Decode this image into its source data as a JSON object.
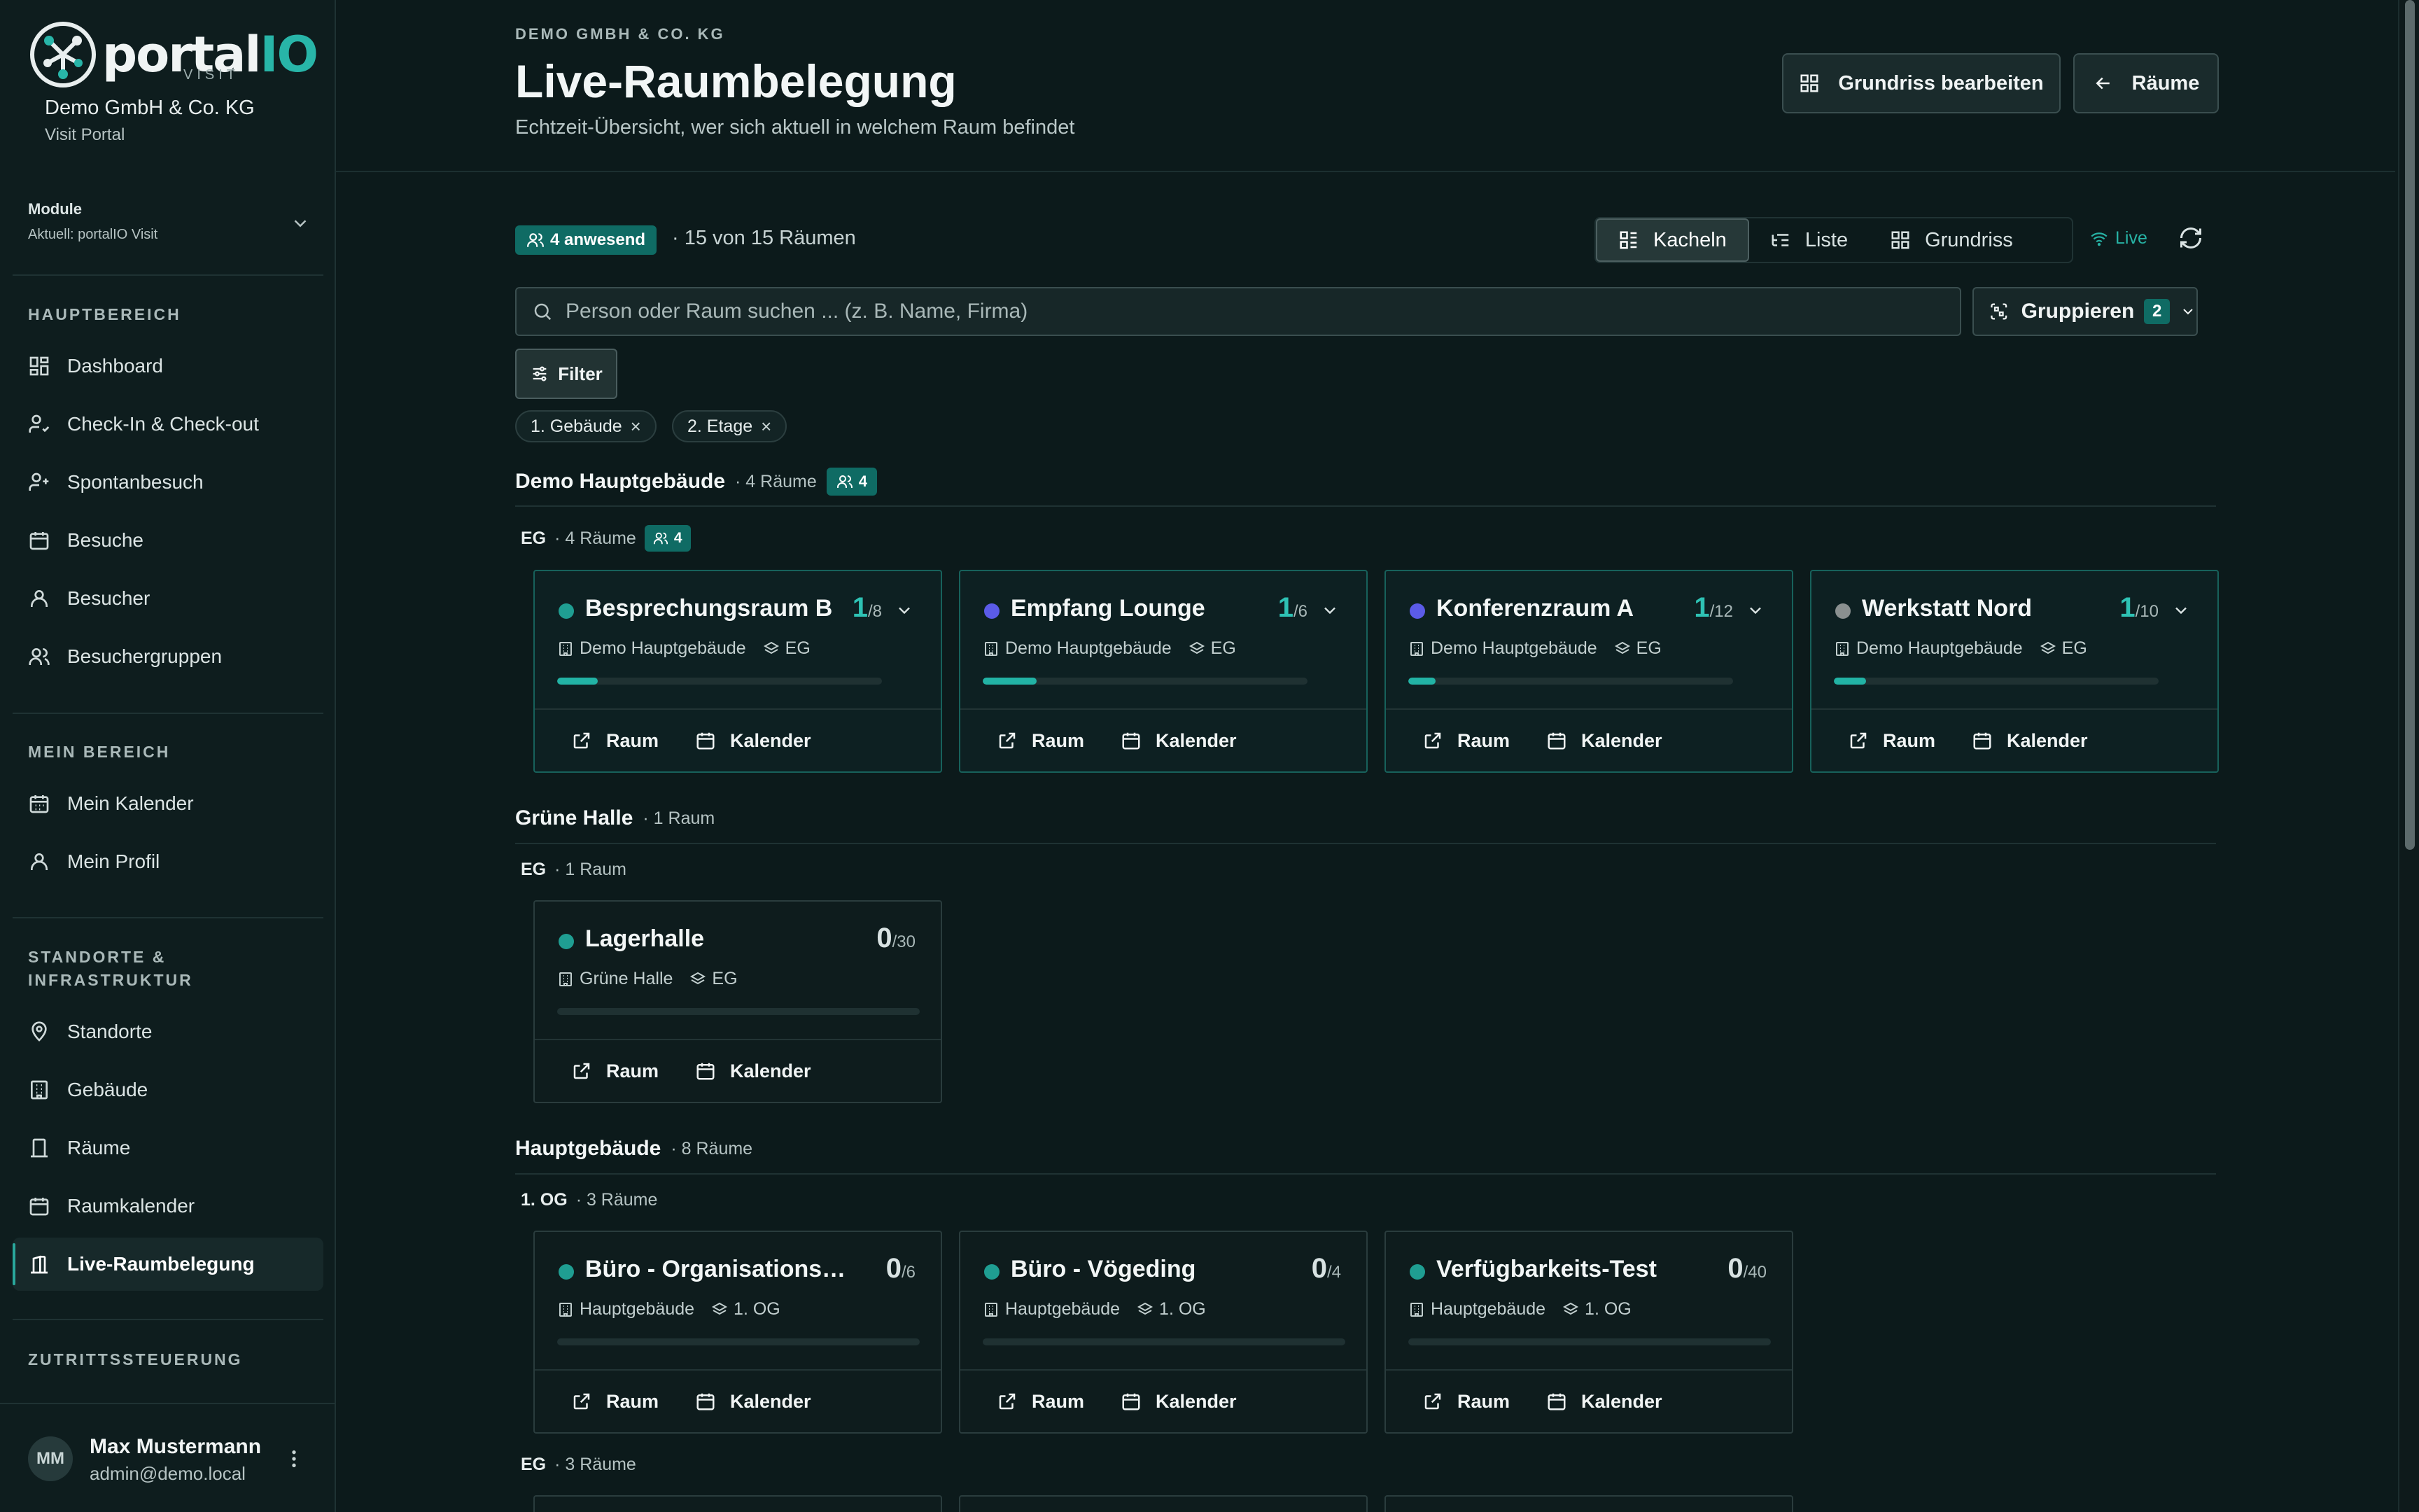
{
  "brand": {
    "name_part1": "portal",
    "name_part2": "IO",
    "sub": "VISIT",
    "company": "Demo GmbH & Co. KG",
    "portal": "Visit Portal"
  },
  "module": {
    "label": "Module",
    "current": "Aktuell: portalIO Visit"
  },
  "sections": {
    "main": "HAUPTBEREICH",
    "mine": "MEIN BEREICH",
    "infra": "STANDORTE & INFRASTRUKTUR",
    "access": "ZUTRITTSSTEUERUNG"
  },
  "nav": {
    "dashboard": "Dashboard",
    "checkin": "Check-In & Check-out",
    "spontan": "Spontanbesuch",
    "besuche": "Besuche",
    "besucher": "Besucher",
    "gruppen": "Besuchergruppen",
    "kalender": "Mein Kalender",
    "profil": "Mein Profil",
    "standorte": "Standorte",
    "gebaeude": "Gebäude",
    "raeume": "Räume",
    "raumkalender": "Raumkalender",
    "live": "Live-Raumbelegung"
  },
  "user": {
    "initials": "MM",
    "name": "Max Mustermann",
    "email": "admin@demo.local"
  },
  "header": {
    "org": "DEMO GMBH & CO. KG",
    "title": "Live-Raumbelegung",
    "subtitle": "Echtzeit-Übersicht, wer sich aktuell in welchem Raum befindet",
    "edit_button": "Grundriss bearbeiten",
    "rooms_button": "Räume"
  },
  "toolbar": {
    "present": "4 anwesend",
    "count": "· 15 von 15 Räumen",
    "views": {
      "tiles": "Kacheln",
      "list": "Liste",
      "floorplan": "Grundriss"
    },
    "live": "Live",
    "search_placeholder": "Person oder Raum suchen ... (z. B. Name, Firma)",
    "group_label": "Gruppieren",
    "group_count": "2",
    "filter_label": "Filter",
    "chips": [
      "1. Gebäude",
      "2. Etage"
    ]
  },
  "groups": [
    {
      "name": "Demo Hauptgebäude",
      "count": "· 4 Räume",
      "present": "4",
      "floors": [
        {
          "name": "EG",
          "count": "· 4 Räume",
          "present": "4"
        }
      ]
    },
    {
      "name": "Grüne Halle",
      "count": "· 1 Raum",
      "floors": [
        {
          "name": "EG",
          "count": "· 1 Raum"
        }
      ]
    },
    {
      "name": "Hauptgebäude",
      "count": "· 8 Räume",
      "floors": [
        {
          "name": "1. OG",
          "count": "· 3 Räume"
        },
        {
          "name": "EG",
          "count": "· 3 Räume"
        }
      ]
    }
  ],
  "cards": {
    "link_room": "Raum",
    "link_calendar": "Kalender",
    "rooms": [
      {
        "name": "Besprechungsraum B",
        "occ": "1",
        "cap": "/8",
        "building": "Demo Hauptgebäude",
        "floor": "EG",
        "dot": "#1f9e92",
        "fill_pct": 12.5
      },
      {
        "name": "Empfang Lounge",
        "occ": "1",
        "cap": "/6",
        "building": "Demo Hauptgebäude",
        "floor": "EG",
        "dot": "#5b5be8",
        "fill_pct": 16.7
      },
      {
        "name": "Konferenzraum A",
        "occ": "1",
        "cap": "/12",
        "building": "Demo Hauptgebäude",
        "floor": "EG",
        "dot": "#5b5be8",
        "fill_pct": 8.3
      },
      {
        "name": "Werkstatt Nord",
        "occ": "1",
        "cap": "/10",
        "building": "Demo Hauptgebäude",
        "floor": "EG",
        "dot": "#8a9090",
        "fill_pct": 10
      },
      {
        "name": "Lagerhalle",
        "occ": "0",
        "cap": "/30",
        "building": "Grüne Halle",
        "floor": "EG",
        "dot": "#1f9e92",
        "fill_pct": 0
      },
      {
        "name": "Büro - Organisationsber...",
        "occ": "0",
        "cap": "/6",
        "building": "Hauptgebäude",
        "floor": "1. OG",
        "dot": "#1f9e92",
        "fill_pct": 0
      },
      {
        "name": "Büro - Vögeding",
        "occ": "0",
        "cap": "/4",
        "building": "Hauptgebäude",
        "floor": "1. OG",
        "dot": "#1f9e92",
        "fill_pct": 0
      },
      {
        "name": "Verfügbarkeits-Test",
        "occ": "0",
        "cap": "/40",
        "building": "Hauptgebäude",
        "floor": "1. OG",
        "dot": "#1f9e92",
        "fill_pct": 0
      }
    ]
  }
}
